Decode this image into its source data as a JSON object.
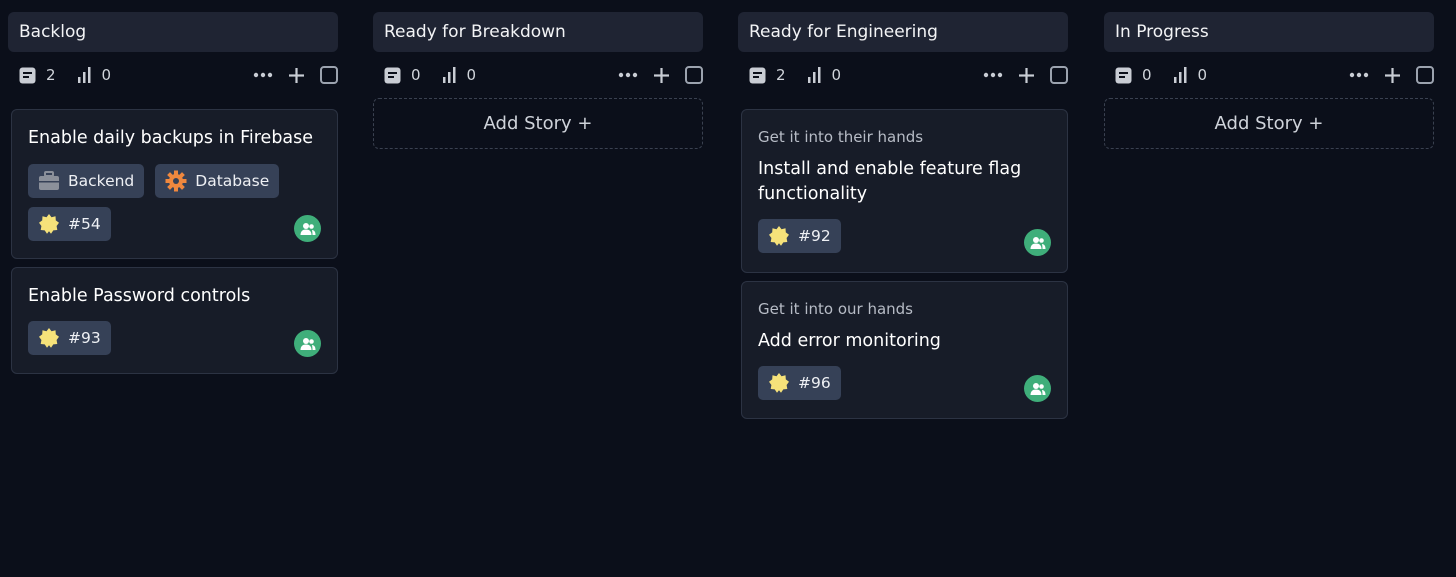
{
  "columns": [
    {
      "title": "Backlog",
      "story_count": "2",
      "points": "0",
      "cards": [
        {
          "title": "Enable daily backups in Firebase",
          "labels": [
            "Backend",
            "Database"
          ],
          "ticket": "#54"
        },
        {
          "title": "Enable Password controls",
          "ticket": "#93"
        }
      ]
    },
    {
      "title": "Ready for Breakdown",
      "story_count": "0",
      "points": "0",
      "add_story_label": "Add Story +"
    },
    {
      "title": "Ready for Engineering",
      "story_count": "2",
      "points": "0",
      "cards": [
        {
          "epic": "Get it into their hands",
          "title": "Install and enable feature flag functionality",
          "ticket": "#92"
        },
        {
          "epic": "Get it into our hands",
          "title": "Add error monitoring",
          "ticket": "#96"
        }
      ]
    },
    {
      "title": "In Progress",
      "story_count": "0",
      "points": "0",
      "add_story_label": "Add Story +"
    }
  ],
  "colors": {
    "background": "#0b0f1a",
    "card": "#171c28",
    "header": "#1f2433",
    "tag": "#364157",
    "avatar": "#3fae7a",
    "database_icon": "#f0883e",
    "ticket_icon": "#f6e27a"
  },
  "icons": {
    "stories": "story-icon",
    "points": "bar-chart-icon",
    "more": "more-icon",
    "add": "plus-icon",
    "select": "checkbox",
    "backend_label": "briefcase-icon",
    "database_label": "gear-icon",
    "ticket": "badge-icon",
    "owner": "user-group-icon"
  }
}
